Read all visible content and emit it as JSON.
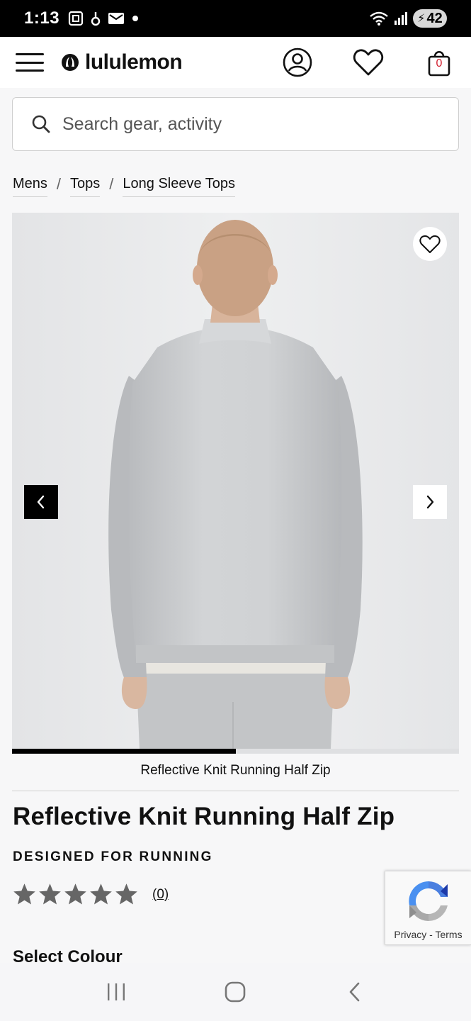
{
  "status_bar": {
    "time": "1:13",
    "battery": "42"
  },
  "header": {
    "brand": "lululemon",
    "bag_count": "0"
  },
  "search": {
    "placeholder": "Search gear, activity"
  },
  "breadcrumb": {
    "items": [
      "Mens",
      "Tops",
      "Long Sleeve Tops"
    ],
    "separator": "/"
  },
  "gallery": {
    "caption": "Reflective Knit Running Half Zip",
    "progress": 0.5
  },
  "product": {
    "title": "Reflective Knit Running Half Zip",
    "tagline": "DESIGNED FOR RUNNING",
    "rating_stars": 5,
    "review_count": "(0)",
    "select_colour_label": "Select Colour"
  },
  "recaptcha": {
    "privacy": "Privacy",
    "separator": "-",
    "terms": "Terms"
  },
  "colors": {
    "accent_red": "#d22030",
    "star_grey": "#666666",
    "image_bg": "#e6e7e9"
  }
}
